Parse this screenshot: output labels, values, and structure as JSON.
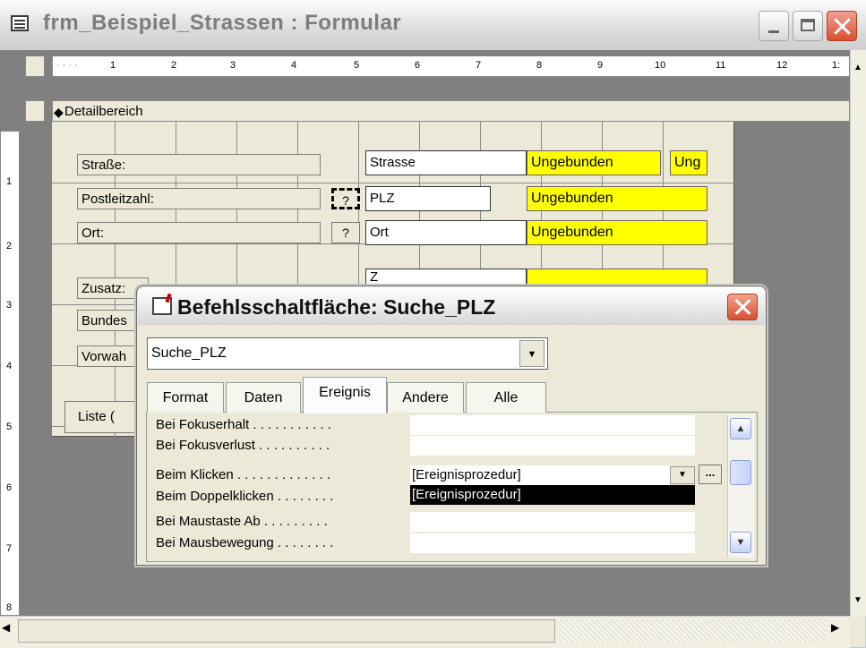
{
  "window": {
    "title": "frm_Beispiel_Strassen : Formular"
  },
  "ruler": {
    "top_numbers": [
      "1",
      "2",
      "3",
      "4",
      "5",
      "6",
      "7",
      "8",
      "9",
      "10",
      "11",
      "12",
      "1:"
    ],
    "left_numbers": [
      "1",
      "2",
      "3",
      "4",
      "5",
      "6",
      "7",
      "8"
    ]
  },
  "section": {
    "label": "Detailbereich"
  },
  "form": {
    "labels": {
      "strasse": "Straße:",
      "plz": "Postleitzahl:",
      "ort": "Ort:",
      "zusatz": "Zusatz:",
      "bundes": "Bundes",
      "vorwahl": "Vorwah"
    },
    "textboxes": {
      "strasse": "Strasse",
      "plz": "PLZ",
      "ort": "Ort",
      "zusatz": "Z"
    },
    "unbound": {
      "u1": "Ungebunden",
      "u1b": "Ung",
      "u2": "Ungebunden",
      "u3": "Ungebunden"
    },
    "qbutton": "?",
    "list_button": "Liste ("
  },
  "dialog": {
    "title": "Befehlsschaltfläche: Suche_PLZ",
    "combo_value": "Suche_PLZ",
    "tabs": [
      "Format",
      "Daten",
      "Ereignis",
      "Andere",
      "Alle"
    ],
    "active_tab": "Ereignis",
    "properties": [
      {
        "label": "Bei Fokuserhalt . . . . . . . . . . .",
        "value": ""
      },
      {
        "label": "Bei Fokusverlust . . . . . . . . . .",
        "value": ""
      },
      {
        "label": "Beim Klicken . . . . . . . . . . . . .",
        "value": "[Ereignisprozedur]"
      },
      {
        "label": "Beim Doppelklicken . . . . . . . .",
        "value": "[Ereignisprozedur]"
      },
      {
        "label": "Bei Maustaste Ab . . . . . . . . .",
        "value": ""
      },
      {
        "label": "Bei Mausbewegung . . . . . . . .",
        "value": ""
      }
    ],
    "builder_button": "..."
  },
  "colors": {
    "unbound_bg": "#ffff00",
    "workspace": "#808080",
    "selection": "#000000"
  }
}
